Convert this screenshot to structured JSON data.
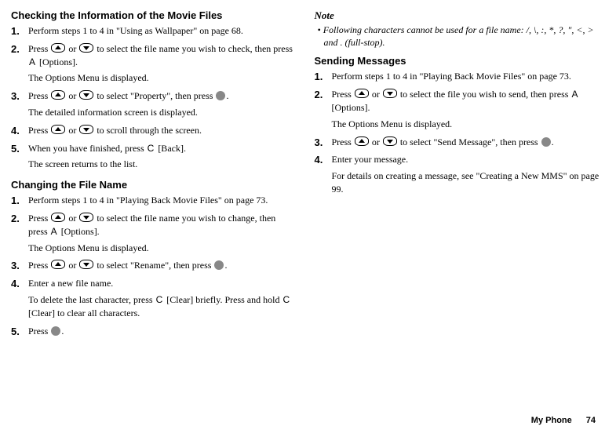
{
  "left": {
    "h1": "Checking the Information of the Movie Files",
    "s1a": "Perform steps 1 to 4 in \"Using as Wallpaper\" on page 68.",
    "s2a": "Press ",
    "s2b": " or ",
    "s2c": " to select the file name you wish to check, then press ",
    "s2key": "A",
    "s2d": " [Options].",
    "s2sub": "The Options Menu is displayed.",
    "s3a": "Press ",
    "s3b": " or ",
    "s3c": " to select \"Property\", then press ",
    "s3d": ".",
    "s3sub": "The detailed information screen is displayed.",
    "s4a": "Press ",
    "s4b": " or ",
    "s4c": " to scroll through the screen.",
    "s5a": "When you have finished, press ",
    "s5key": "C",
    "s5b": " [Back].",
    "s5sub": "The screen returns to the list.",
    "h2": "Changing the File Name",
    "c1a": "Perform steps 1 to 4 in \"Playing Back Movie Files\" on page 73.",
    "c2a": "Press ",
    "c2b": " or ",
    "c2c": " to select the file name you wish to change, then press ",
    "c2key": "A",
    "c2d": " [Options].",
    "c2sub": "The Options Menu is displayed.",
    "c3a": "Press ",
    "c3b": " or ",
    "c3c": " to select \"Rename\", then press ",
    "c3d": ".",
    "c4a": "Enter a new file name.",
    "c4suba": "To delete the last character, press ",
    "c4key1": "C",
    "c4subb": " [Clear] briefly. Press and hold ",
    "c4key2": "C",
    "c4subc": " [Clear] to clear all characters.",
    "c5a": "Press ",
    "c5b": "."
  },
  "right": {
    "noteHead": "Note",
    "noteBullet": "• ",
    "noteBody": "Following characters cannot be used for a file name: /, \\, :, *, ?, \", <, > and . (full-stop).",
    "h1": "Sending Messages",
    "s1a": "Perform steps 1 to 4 in \"Playing Back Movie Files\" on page 73.",
    "s2a": "Press ",
    "s2b": " or ",
    "s2c": " to select the file you wish to send, then press ",
    "s2key": "A",
    "s2d": " [Options].",
    "s2sub": "The Options Menu is displayed.",
    "s3a": "Press ",
    "s3b": " or ",
    "s3c": " to select \"Send Message\", then press ",
    "s3d": ".",
    "s4a": "Enter your message.",
    "s4sub": "For details on creating a message, see \"Creating a New MMS\" on page 99."
  },
  "footer": {
    "section": "My Phone",
    "page": "74"
  }
}
